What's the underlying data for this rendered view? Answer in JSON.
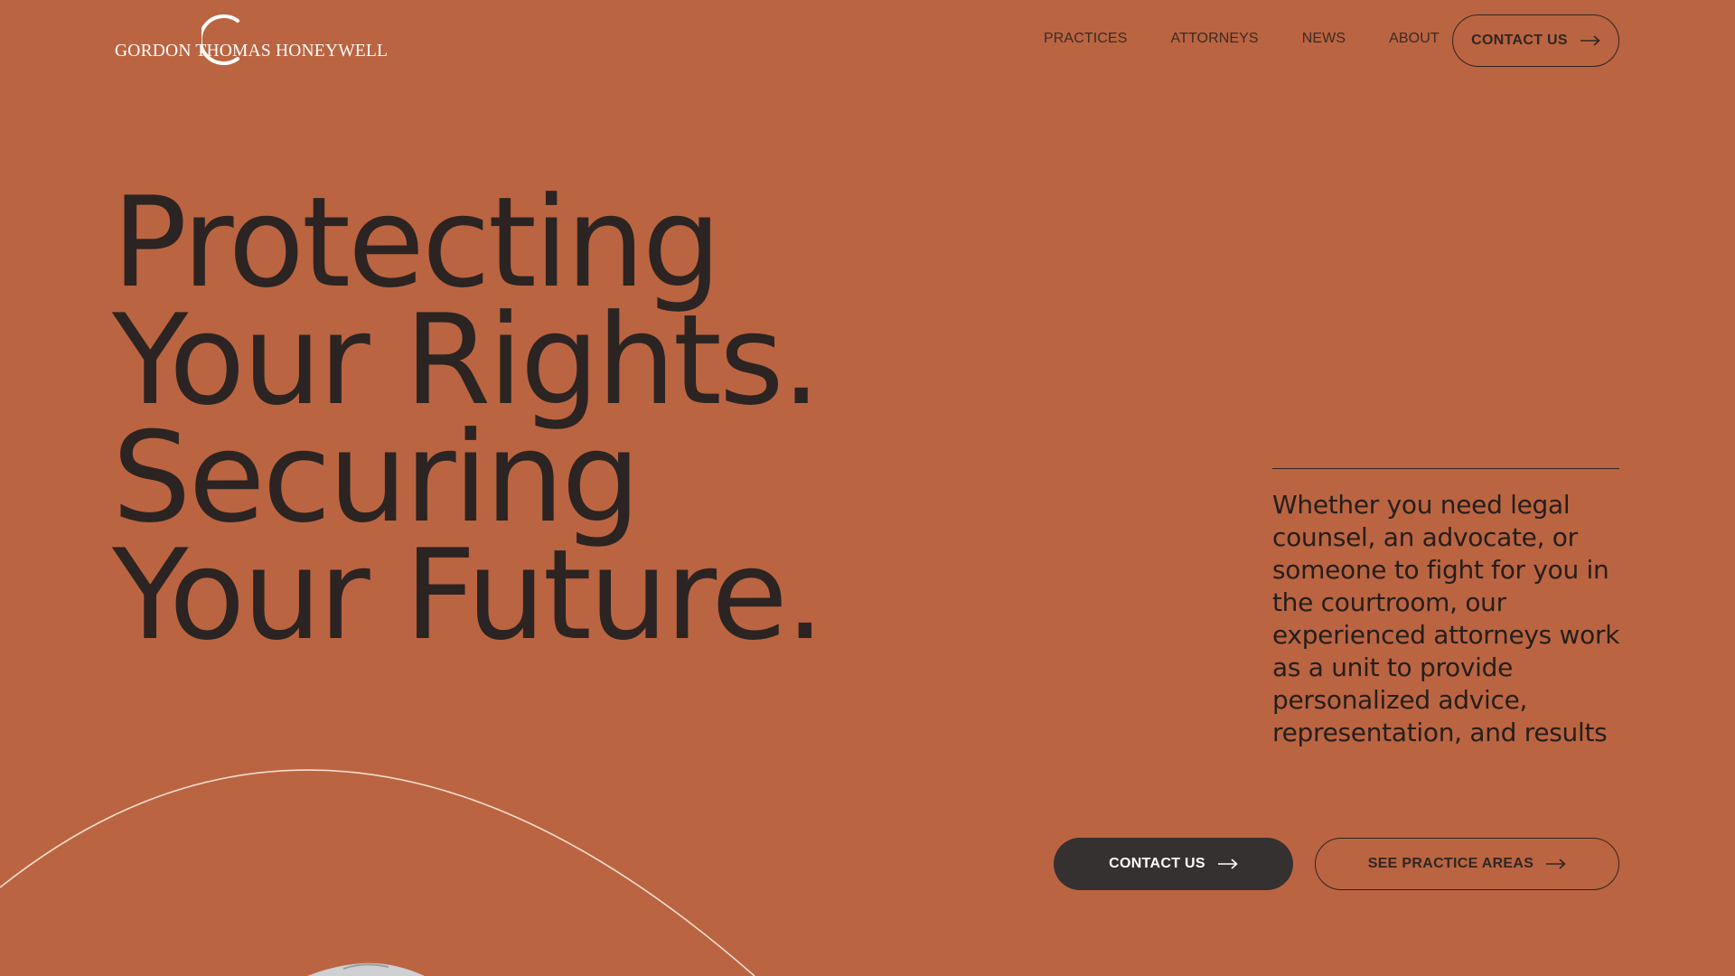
{
  "header": {
    "logo_text": "GORDON THOMAS HONEYWELL",
    "nav": [
      {
        "label": "PRACTICES"
      },
      {
        "label": "ATTORNEYS"
      },
      {
        "label": "NEWS"
      },
      {
        "label": "ABOUT"
      }
    ],
    "contact_label": "CONTACT US"
  },
  "hero": {
    "title_lines": [
      "Protecting",
      "Your Rights.",
      "Securing",
      "Your Future."
    ],
    "description": "Whether you need legal counsel, an advocate, or someone to fight for you in the courtroom, our experienced attorneys work as a unit to provide personalized advice, representation, and results",
    "primary_cta": "CONTACT US",
    "secondary_cta": "SEE PRACTICE AREAS"
  },
  "icons": {
    "arrow": "arrow-right-icon",
    "logo_mark": "logo-g-mark-icon"
  },
  "colors": {
    "background": "#bb6441",
    "text": "#2b2422",
    "dark_button": "#353130",
    "logo": "#ffffff"
  }
}
